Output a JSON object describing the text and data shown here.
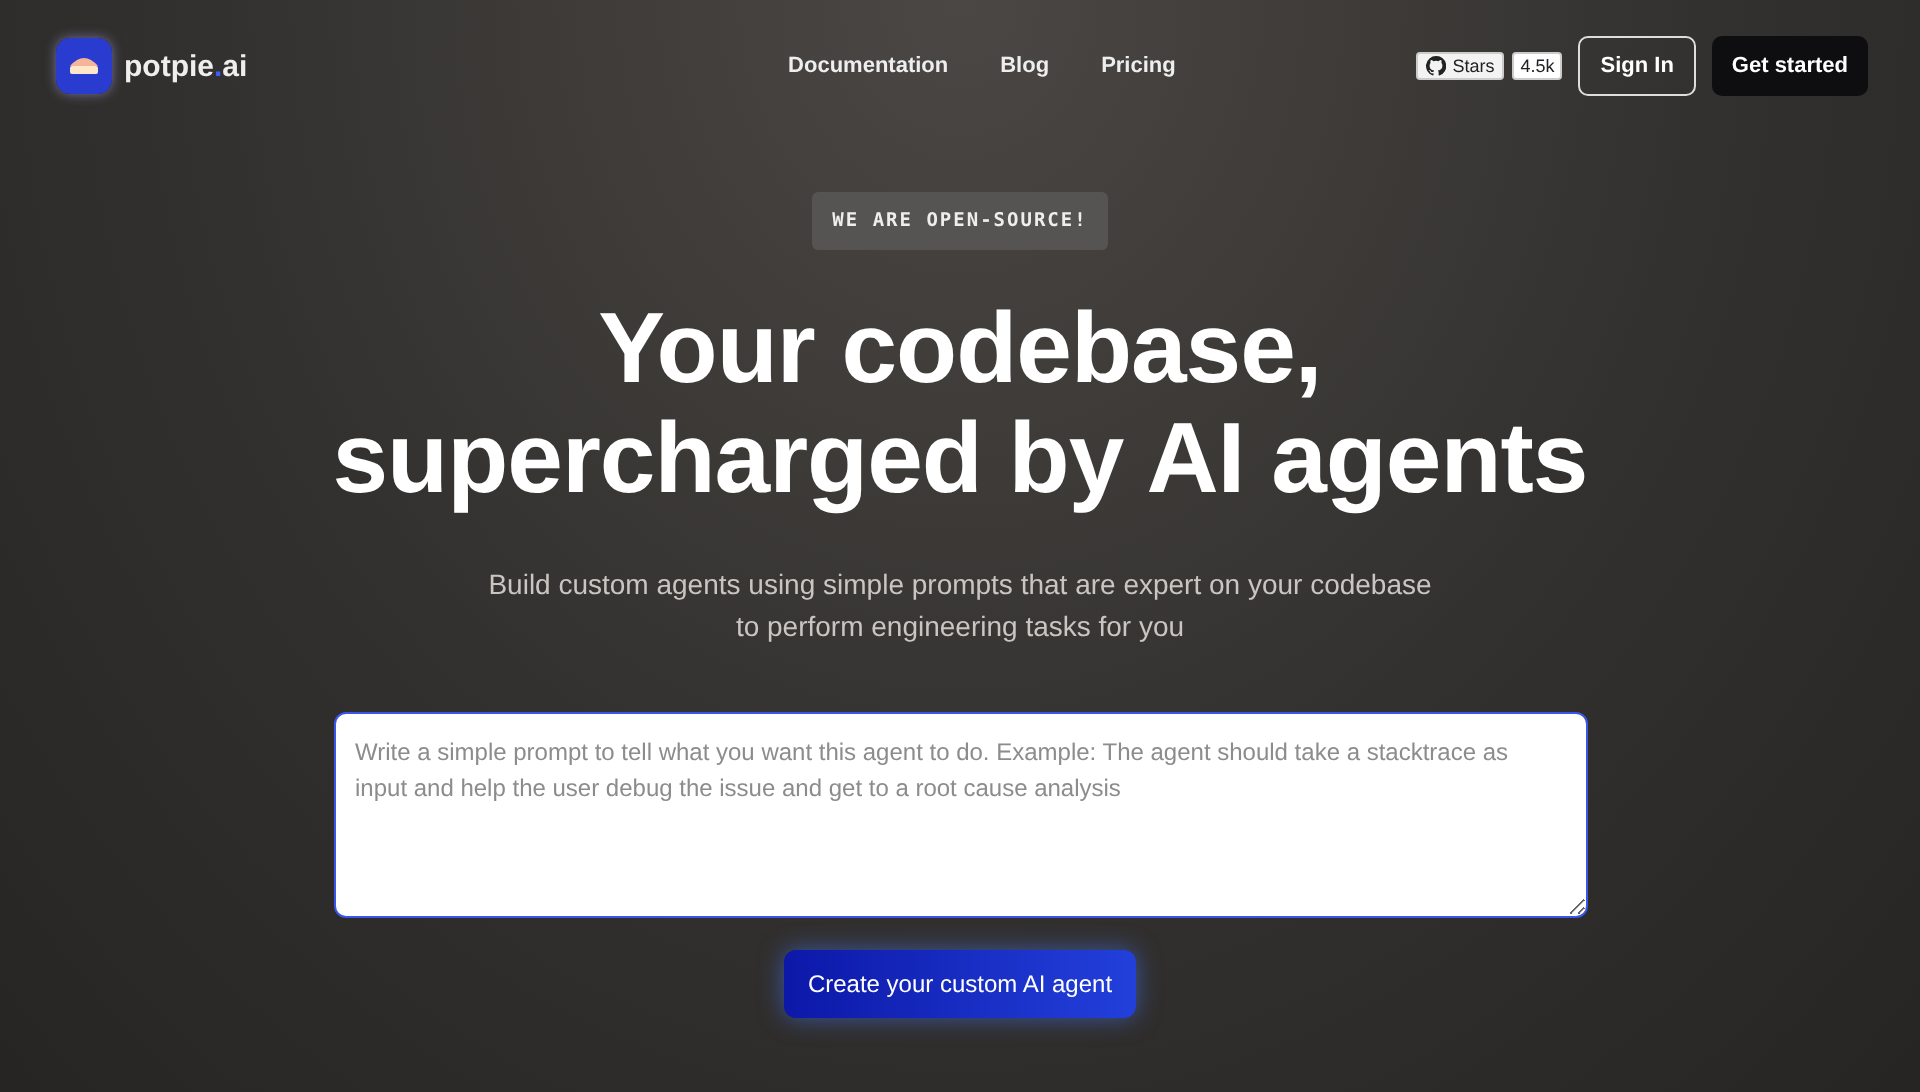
{
  "logo": {
    "name": "potpie",
    "dot": ".",
    "suffix": "ai"
  },
  "nav": [
    {
      "label": "Documentation"
    },
    {
      "label": "Blog"
    },
    {
      "label": "Pricing"
    }
  ],
  "github": {
    "label": "Stars",
    "count": "4.5k"
  },
  "actions": [
    {
      "label": "Sign In",
      "kind": "outline"
    },
    {
      "label": "Get started",
      "kind": "solid"
    }
  ],
  "badge": "WE ARE OPEN-SOURCE!",
  "headline": [
    "Your codebase,",
    "supercharged by AI agents"
  ],
  "subtitle": [
    "Build custom agents using simple prompts that are expert on your codebase",
    "to perform engineering tasks for you"
  ],
  "prompt": {
    "placeholder": "Write a simple prompt to tell what you want this agent to do. Example: The agent should take a stacktrace as input and help the user debug the issue and get to a root cause analysis"
  },
  "cta": "Create your custom AI agent"
}
